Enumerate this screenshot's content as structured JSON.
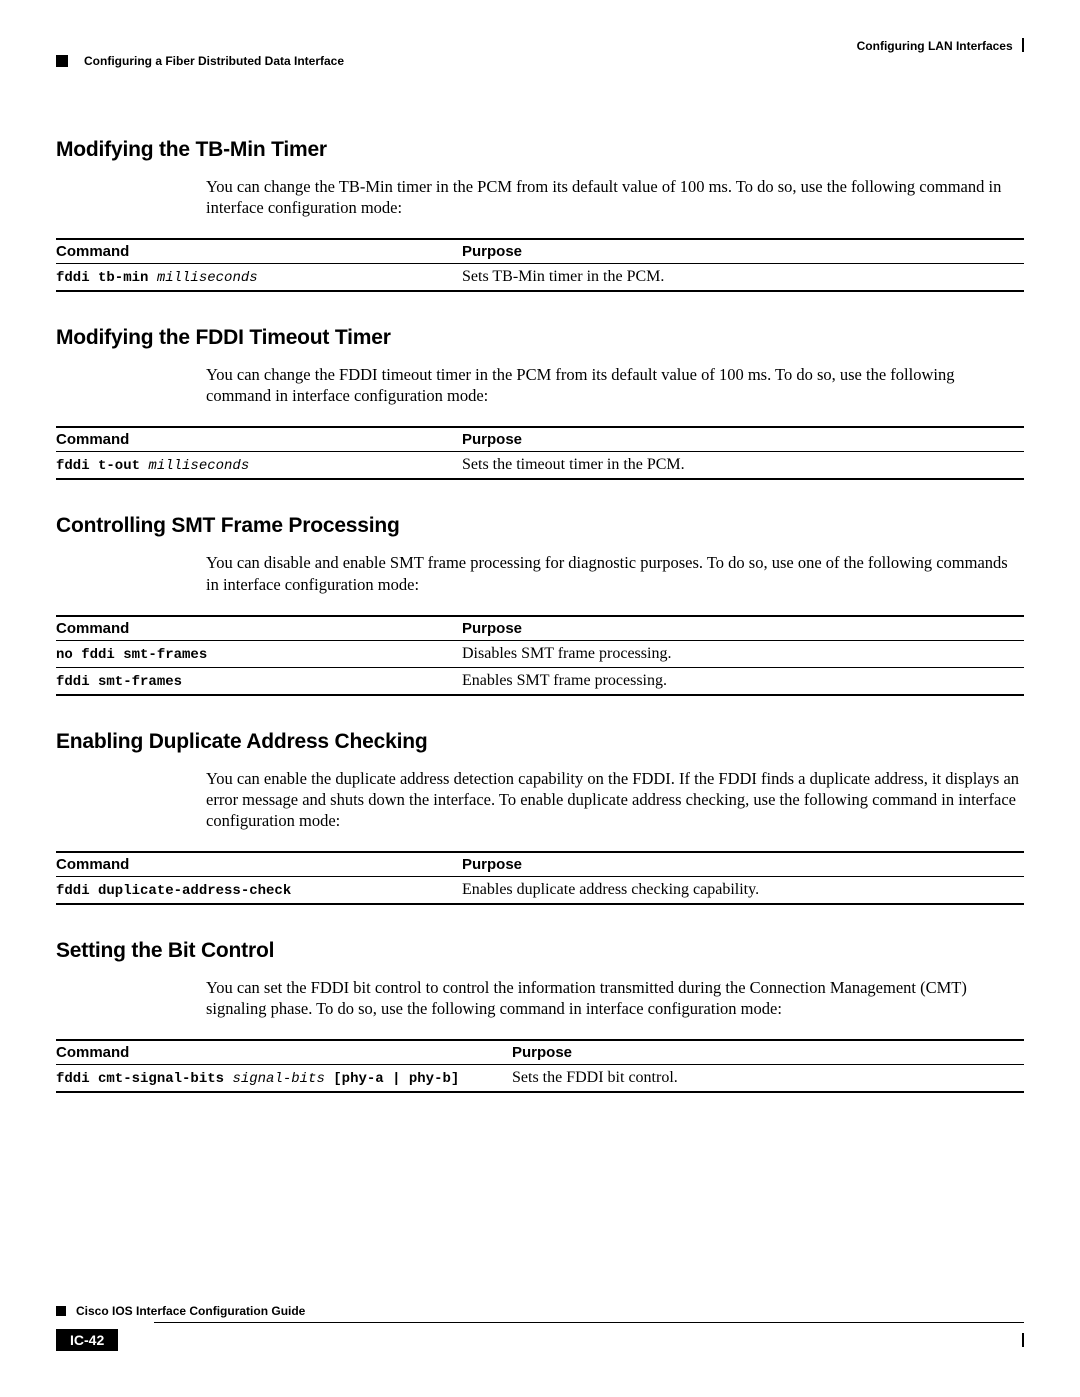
{
  "header": {
    "right": "Configuring LAN Interfaces",
    "breadcrumb": "Configuring a Fiber Distributed Data Interface"
  },
  "sections": [
    {
      "title": "Modifying the TB-Min Timer",
      "para": "You can change the TB-Min timer in the PCM from its default value of 100 ms. To do so, use the following command in interface configuration mode:",
      "th_cmd": "Command",
      "th_purpose": "Purpose",
      "rows": [
        {
          "cmdB": "fddi tb-min ",
          "cmdI": "milliseconds",
          "cmdT": "",
          "purpose": "Sets TB-Min timer in the PCM."
        }
      ]
    },
    {
      "title": "Modifying the FDDI Timeout Timer",
      "para": "You can change the FDDI timeout timer in the PCM from its default value of 100 ms. To do so, use the following command in interface configuration mode:",
      "th_cmd": "Command",
      "th_purpose": "Purpose",
      "rows": [
        {
          "cmdB": "fddi t-out ",
          "cmdI": "milliseconds",
          "cmdT": "",
          "purpose": "Sets the timeout timer in the PCM."
        }
      ]
    },
    {
      "title": "Controlling SMT Frame Processing",
      "para": "You can disable and enable SMT frame processing for diagnostic purposes. To do so, use one of the following commands in interface configuration mode:",
      "th_cmd": "Command",
      "th_purpose": "Purpose",
      "rows": [
        {
          "cmdB": "no fddi smt-frames",
          "cmdI": "",
          "cmdT": "",
          "purpose": "Disables SMT frame processing."
        },
        {
          "cmdB": "fddi smt-frames",
          "cmdI": "",
          "cmdT": "",
          "purpose": "Enables SMT frame processing."
        }
      ]
    },
    {
      "title": "Enabling Duplicate Address Checking",
      "para": "You can enable the duplicate address detection capability on the FDDI. If the FDDI finds a duplicate address, it displays an error message and shuts down the interface. To enable duplicate address checking, use the following command in interface configuration mode:",
      "th_cmd": "Command",
      "th_purpose": "Purpose",
      "rows": [
        {
          "cmdB": "fddi duplicate-address-check",
          "cmdI": "",
          "cmdT": "",
          "purpose": "Enables duplicate address checking capability."
        }
      ]
    },
    {
      "title": "Setting the Bit Control",
      "para": "You can set the FDDI bit control to control the information transmitted during the Connection Management (CMT) signaling phase. To do so, use the following command in interface configuration mode:",
      "th_cmd": "Command",
      "th_purpose": "Purpose",
      "rows": [
        {
          "cmdB": "fddi cmt-signal-bits ",
          "cmdI": "signal-bits",
          "cmdT": " [phy-a | phy-b]",
          "purpose": "Sets the FDDI bit control."
        }
      ],
      "cmdWide": true
    }
  ],
  "footer": {
    "guide": "Cisco IOS Interface Configuration Guide",
    "page": "IC-42"
  }
}
